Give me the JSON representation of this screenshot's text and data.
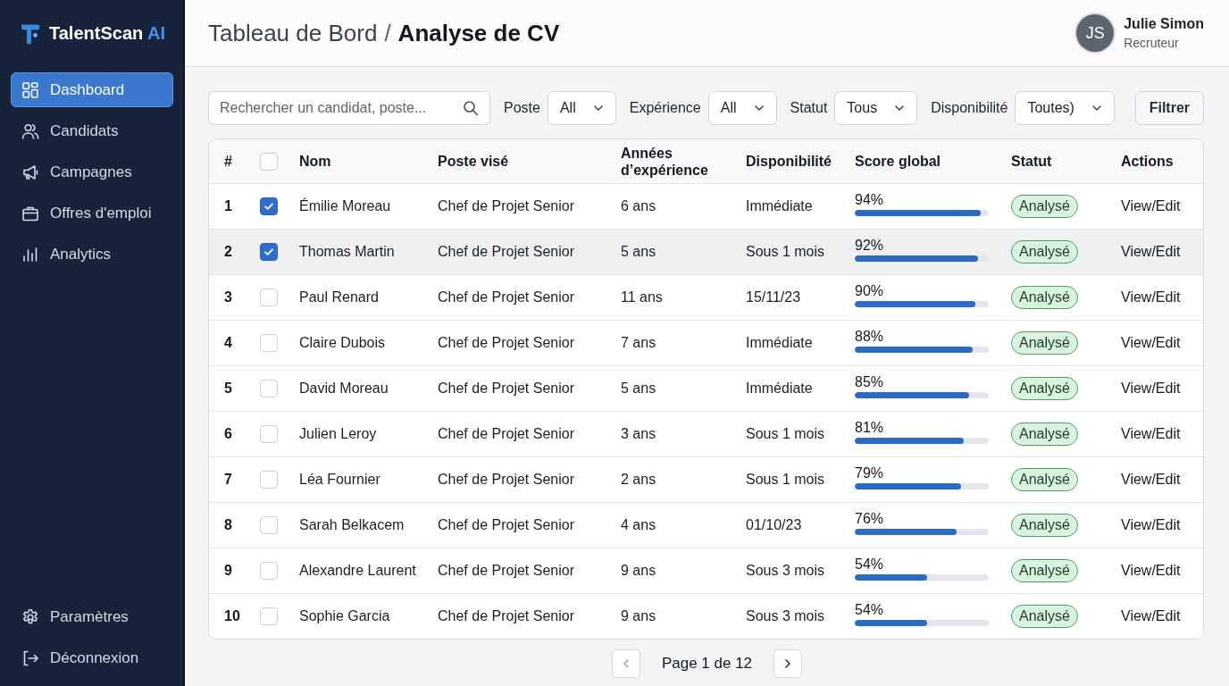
{
  "sidebar": {
    "logo": {
      "name": "TalentScan",
      "suffix": "AI"
    },
    "items": [
      {
        "label": "Dashboard",
        "selected": true
      },
      {
        "label": "Candidats",
        "selected": false
      },
      {
        "label": "Campagnes",
        "selected": false
      },
      {
        "label": "Offres d'emploi",
        "selected": false
      },
      {
        "label": "Analytics",
        "selected": false
      }
    ],
    "footer_items": [
      {
        "label": "Paramètres"
      },
      {
        "label": "Déconnexion"
      }
    ]
  },
  "header": {
    "breadcrumb": {
      "parent": "Tableau de Bord",
      "separator": "/",
      "current": "Analyse de CV"
    },
    "user": {
      "initials": "JS",
      "name": "Julie Simon",
      "role": "Recruteur"
    }
  },
  "filters": {
    "search": {
      "placeholder": "Rechercher un candidat, poste..."
    },
    "selects": [
      {
        "label": "Poste",
        "value": "All"
      },
      {
        "label": "Expérience",
        "value": "All"
      },
      {
        "label": "Statut",
        "value": "Tous"
      },
      {
        "label": "Disponibilité",
        "value": "Toutes)"
      }
    ],
    "button": "Filtrer"
  },
  "table": {
    "select_all": {
      "checked": false
    },
    "columns": [
      "#",
      "Nom",
      "Poste visé",
      "Années d’expérience",
      "Disponibilité",
      "Score global",
      "Statut",
      "Actions"
    ],
    "rows": [
      {
        "index": "1",
        "checked": true,
        "highlighted": false,
        "name": "Émilie Moreau",
        "position": "Chef de Projet Senior",
        "experience": "6 ans",
        "availability": "Immédiate",
        "score": "94%",
        "level": 0.94,
        "status": "Analysé",
        "action": "View/Edit"
      },
      {
        "index": "2",
        "checked": true,
        "highlighted": true,
        "name": "Thomas Martin",
        "position": "Chef de Projet Senior",
        "experience": "5 ans",
        "availability": "Sous 1 mois",
        "score": "92%",
        "level": 0.92,
        "status": "Analysé",
        "action": "View/Edit"
      },
      {
        "index": "3",
        "checked": false,
        "highlighted": false,
        "name": "Paul Renard",
        "position": "Chef de Projet Senior",
        "experience": "11 ans",
        "availability": "15/11/23",
        "score": "90%",
        "level": 0.9,
        "status": "Analysé",
        "action": "View/Edit"
      },
      {
        "index": "4",
        "checked": false,
        "highlighted": false,
        "name": "Claire Dubois",
        "position": "Chef de Projet Senior",
        "experience": "7 ans",
        "availability": "Immédiate",
        "score": "88%",
        "level": 0.88,
        "status": "Analysé",
        "action": "View/Edit"
      },
      {
        "index": "5",
        "checked": false,
        "highlighted": false,
        "name": "David Moreau",
        "position": "Chef de Projet Senior",
        "experience": "5 ans",
        "availability": "Immédiate",
        "score": "85%",
        "level": 0.85,
        "status": "Analysé",
        "action": "View/Edit"
      },
      {
        "index": "6",
        "checked": false,
        "highlighted": false,
        "name": "Julien Leroy",
        "position": "Chef de Projet Senior",
        "experience": "3 ans",
        "availability": "Sous 1 mois",
        "score": "81%",
        "level": 0.81,
        "status": "Analysé",
        "action": "View/Edit"
      },
      {
        "index": "7",
        "checked": false,
        "highlighted": false,
        "name": "Léa Fournier",
        "position": "Chef de Projet Senior",
        "experience": "2 ans",
        "availability": "Sous 1 mois",
        "score": "79%",
        "level": 0.79,
        "status": "Analysé",
        "action": "View/Edit"
      },
      {
        "index": "8",
        "checked": false,
        "highlighted": false,
        "name": "Sarah Belkacem",
        "position": "Chef de Projet Senior",
        "experience": "4 ans",
        "availability": "01/10/23",
        "score": "76%",
        "level": 0.76,
        "status": "Analysé",
        "action": "View/Edit"
      },
      {
        "index": "9",
        "checked": false,
        "highlighted": false,
        "name": "Alexandre Laurent",
        "position": "Chef de Projet Senior",
        "experience": "9 ans",
        "availability": "Sous 3 mois",
        "score": "54%",
        "level": 0.54,
        "status": "Analysé",
        "action": "View/Edit"
      },
      {
        "index": "10",
        "checked": false,
        "highlighted": false,
        "name": "Sophie Garcia",
        "position": "Chef de Projet Senior",
        "experience": "9 ans",
        "availability": "Sous 3 mois",
        "score": "54%",
        "level": 0.54,
        "status": "Analysé",
        "action": "View/Edit"
      }
    ]
  },
  "pagination": {
    "label": "Page 1 de 12"
  }
}
